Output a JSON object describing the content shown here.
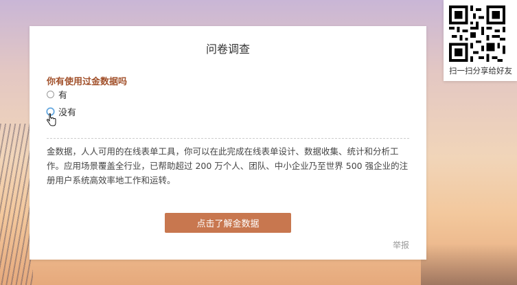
{
  "survey": {
    "title": "问卷调查",
    "question": "你有使用过金数据吗",
    "options": [
      "有",
      "没有"
    ],
    "description": "金数据，人人可用的在线表单工具，你可以在此完成在线表单设计、数据收集、统计和分析工作。应用场景覆盖全行业，已帮助超过 200 万个人、团队、中小企业乃至世界 500 强企业的注册用户系统高效率地工作和运转。",
    "cta_label": "点击了解金数据",
    "report_label": "举报"
  },
  "share": {
    "label": "扫一扫分享给好友"
  },
  "colors": {
    "question": "#a1502a",
    "cta_bg": "#c8774f",
    "radio_hover": "#3a8fd6"
  },
  "icons": {
    "cursor": "hand-pointer-icon",
    "qr": "qr-code-icon"
  }
}
